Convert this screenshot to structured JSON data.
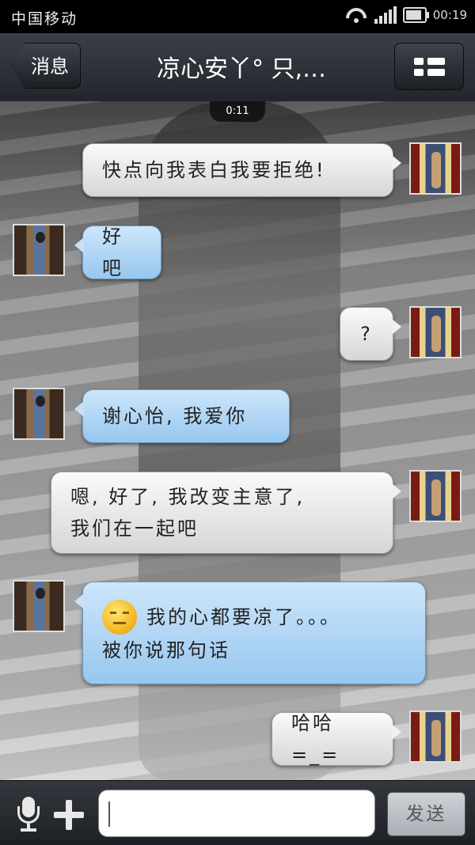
{
  "status_bar": {
    "carrier": "中国移动",
    "time": "00:19",
    "battery_level": 0.75,
    "icons": [
      "wifi-icon",
      "signal-icon",
      "battery-icon"
    ]
  },
  "header": {
    "back_label": "消息",
    "title": "凉心安丫° 只,…",
    "menu_icon": "list-menu-icon"
  },
  "chat": {
    "timer": "0:11",
    "messages": [
      {
        "sender": "me",
        "text": "快点向我表白我要拒绝!"
      },
      {
        "sender": "other",
        "text": "好吧"
      },
      {
        "sender": "me",
        "text": "?"
      },
      {
        "sender": "other",
        "text": "谢心怡, 我爱你"
      },
      {
        "sender": "me",
        "line1": "嗯, 好了, 我改变主意了,",
        "line2": "我们在一起吧"
      },
      {
        "sender": "other",
        "line1": "我的心都要凉了。。。",
        "line2": "被你说那句话",
        "emoji": "annoyed-face-icon"
      },
      {
        "sender": "me",
        "text": "哈哈=_="
      }
    ]
  },
  "composer": {
    "send_label": "发送",
    "input_value": "",
    "icons": [
      "microphone-icon",
      "plus-icon"
    ]
  },
  "colors": {
    "outgoing_bubble": "#e6e6e6",
    "incoming_bubble": "#b3d6f5",
    "bar_dark": "#2a2e34"
  }
}
